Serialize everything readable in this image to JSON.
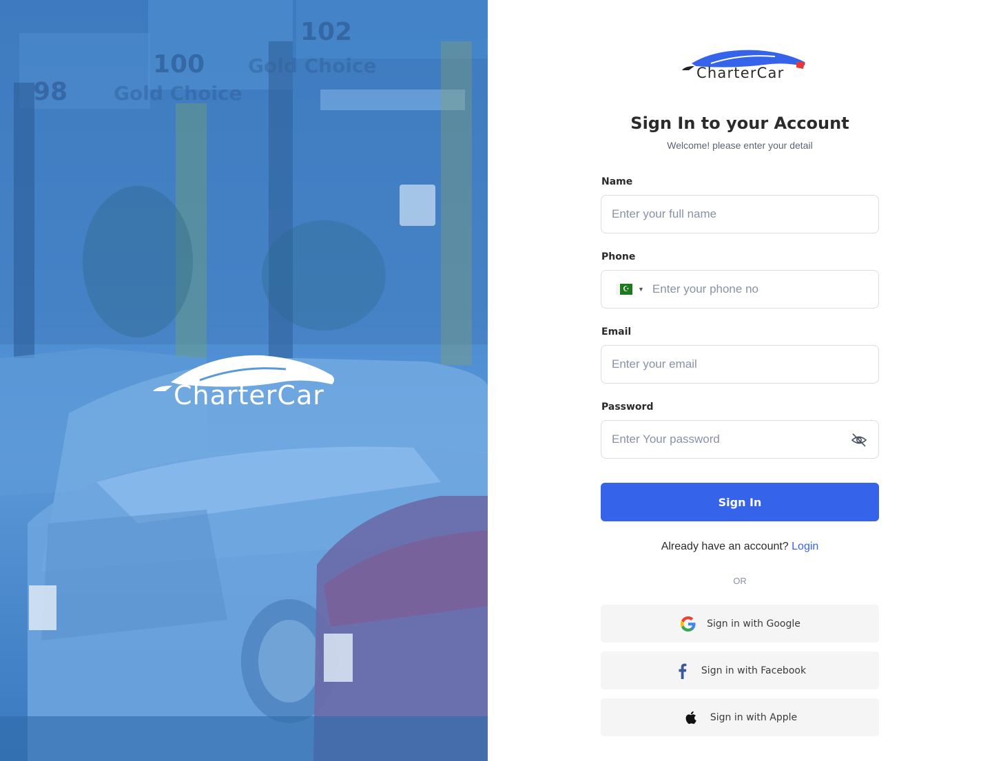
{
  "hero": {
    "brand_text": "ChartCar",
    "brand_full": "CharterCar",
    "sign_numbers": [
      "98",
      "100",
      "102"
    ],
    "sign_texts": [
      "Gold Choice"
    ]
  },
  "brand": {
    "text": "CharterCar"
  },
  "header": {
    "title": "Sign In to your Account",
    "subtitle": "Welcome! please enter your detail"
  },
  "form": {
    "name": {
      "label": "Name",
      "placeholder": "Enter your full name"
    },
    "phone": {
      "label": "Phone",
      "placeholder": "Enter your phone no",
      "country_icon": "pakistan-flag-icon"
    },
    "email": {
      "label": "Email",
      "placeholder": "Enter your email"
    },
    "password": {
      "label": "Password",
      "placeholder": "Enter Your password",
      "toggle_icon": "eye-off-icon"
    },
    "submit_label": "Sign In"
  },
  "footer": {
    "already_text": "Already have an account?",
    "login_link": "Login",
    "or_text": "OR"
  },
  "social": [
    {
      "label": "Sign in with Google",
      "icon": "google-icon"
    },
    {
      "label": "Sign in with Facebook",
      "icon": "facebook-icon"
    },
    {
      "label": "Sign in with Apple",
      "icon": "apple-icon"
    }
  ],
  "colors": {
    "primary": "#3563e9",
    "hero_overlay": "#3f7fc6",
    "social_bg": "#f5f5f6",
    "input_border": "#d8dde6"
  }
}
